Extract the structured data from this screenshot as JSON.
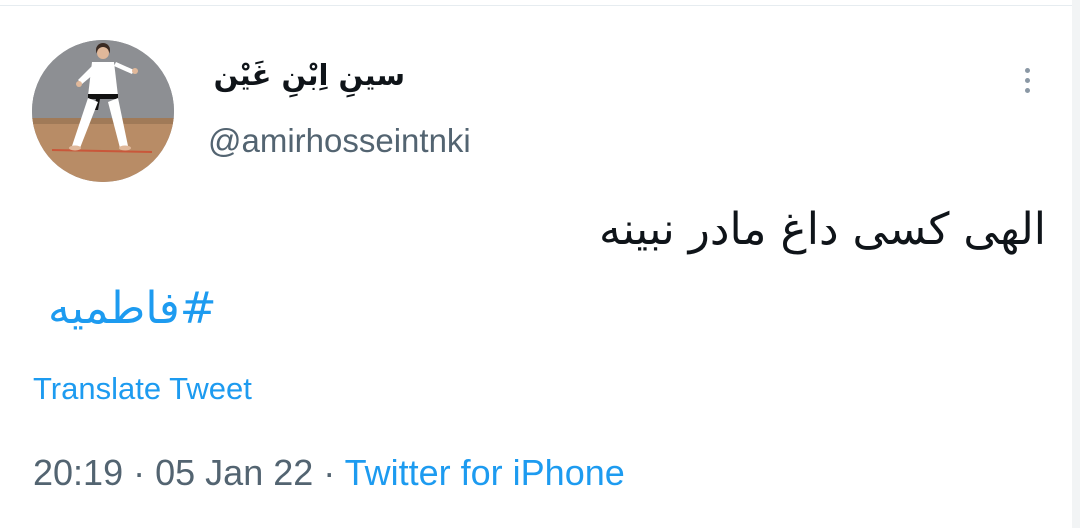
{
  "tweet": {
    "display_name": "سینِ اِبْنِ غَیْن",
    "handle": "@amirhosseintnki",
    "text": "الهی کسی داغ مادر نبینه",
    "hashtag": "#فاطمیه",
    "translate_label": "Translate Tweet",
    "time": "20:19",
    "separator": "·",
    "date": "05 Jan 22",
    "source": "Twitter for iPhone",
    "more_icon": "more-vertical-icon"
  },
  "colors": {
    "link": "#1d9bf0",
    "secondary_text": "#536471",
    "primary_text": "#0f1419"
  }
}
